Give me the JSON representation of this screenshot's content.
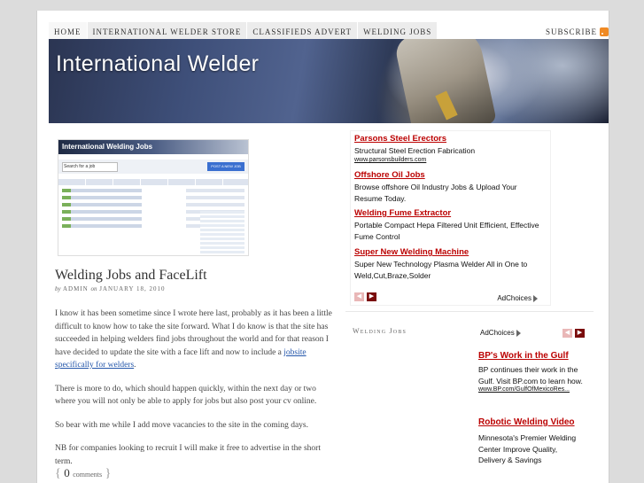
{
  "nav": {
    "items": [
      "HOME",
      "INTERNATIONAL WELDER STORE",
      "CLASSIFIEDS ADVERT",
      "WELDING JOBS"
    ],
    "subscribe": "SUBSCRIBE"
  },
  "header": {
    "site_title": "International Welder"
  },
  "thumbnail": {
    "banner": "International Welding Jobs",
    "search_placeholder": "Search for a job",
    "button": "POST A NEW JOB"
  },
  "post": {
    "title": "Welding Jobs and FaceLift",
    "by": "by",
    "author": "ADMIN",
    "on": "on",
    "date": "JANUARY 18, 2010",
    "p1_text": "I know it has been sometime since I wrote here last, probably as it has been a little difficult to know how to take the site forward. What I do know is that the site has succeeded in helping welders find jobs throughout the world and for that reason I have decided to update the site with a face lift and now to include a ",
    "p1_link": "jobsite specifically for welders",
    "p1_end": ".",
    "p2": "There is more to do, which should happen quickly, within the next day or two where you will not only be able to apply for jobs but also post your cv online.",
    "p3": "So bear with me while I add move vacancies to the site in the coming days.",
    "p4": "NB for companies looking to recruit I will make it free to advertise in the short term.",
    "comments_count": "0",
    "comments_label": "comments"
  },
  "ads_top": [
    {
      "title": "Parsons Steel Erectors",
      "desc": "Structural Steel Erection Fabrication",
      "url": "www.parsonsbuilders.com"
    },
    {
      "title": "Offshore Oil Jobs",
      "desc": "Browse offshore Oil Industry Jobs & Upload Your Resume Today.",
      "url": ""
    },
    {
      "title": "Welding Fume Extractor",
      "desc": "Portable Compact Hepa Filtered Unit Efficient, Effective Fume Control",
      "url": ""
    },
    {
      "title": "Super New Welding Machine",
      "desc": "Super New Technology Plasma Welder All in One to Weld,Cut,Braze,Solder",
      "url": ""
    }
  ],
  "adchoices": "AdChoices",
  "sidebar": {
    "title": "Welding Jobs",
    "ads": [
      {
        "title": "BP's Work in the Gulf",
        "desc": "BP continues their work in the Gulf. Visit BP.com to learn how.",
        "url": "www.BP.com/GulfOfMexicoRes..."
      },
      {
        "title": "Robotic Welding Video",
        "desc": "Minnesota's Premier Welding Center Improve Quality, Delivery & Savings",
        "url": ""
      }
    ]
  },
  "colors": {
    "ad_title": "#bb0000",
    "link": "#2255aa",
    "nav_bg": "#ececec"
  }
}
